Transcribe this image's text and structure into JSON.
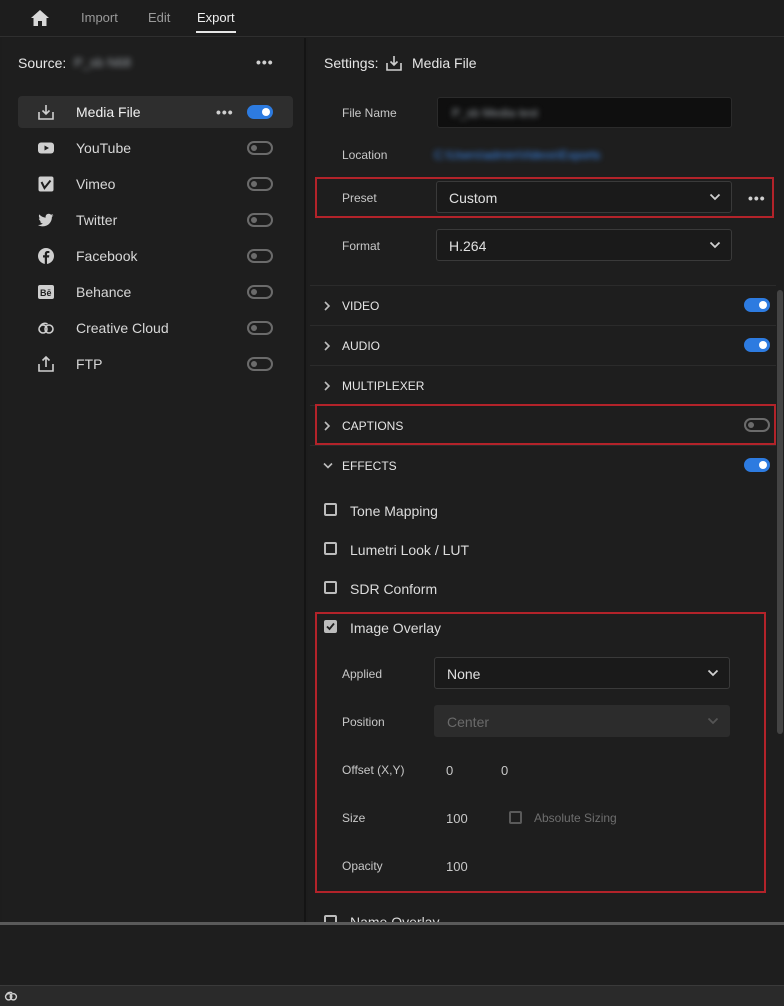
{
  "topbar": {
    "tabs": [
      {
        "label": "Import",
        "active": false
      },
      {
        "label": "Edit",
        "active": false
      },
      {
        "label": "Export",
        "active": true
      }
    ]
  },
  "source": {
    "label": "Source:",
    "value": "P_sb N68",
    "more": "•••"
  },
  "destinations": [
    {
      "label": "Media File",
      "icon": "download-icon",
      "enabled": true,
      "selected": true
    },
    {
      "label": "YouTube",
      "icon": "youtube-icon",
      "enabled": false
    },
    {
      "label": "Vimeo",
      "icon": "vimeo-icon",
      "enabled": false
    },
    {
      "label": "Twitter",
      "icon": "twitter-icon",
      "enabled": false
    },
    {
      "label": "Facebook",
      "icon": "facebook-icon",
      "enabled": false
    },
    {
      "label": "Behance",
      "icon": "behance-icon",
      "enabled": false
    },
    {
      "label": "Creative Cloud",
      "icon": "creative-cloud-icon",
      "enabled": false
    },
    {
      "label": "FTP",
      "icon": "share-upload-icon",
      "enabled": false
    }
  ],
  "settings": {
    "label": "Settings:",
    "target": "Media File",
    "more": "•••",
    "file_name_label": "File Name",
    "file_name_value": "P_sb Media test",
    "location_label": "Location",
    "location_value": "C:\\Users\\admin\\Videos\\Exports",
    "preset_label": "Preset",
    "preset_value": "Custom",
    "format_label": "Format",
    "format_value": "H.264"
  },
  "sections": [
    {
      "label": "VIDEO",
      "expanded": false,
      "toggle": true
    },
    {
      "label": "AUDIO",
      "expanded": false,
      "toggle": true
    },
    {
      "label": "MULTIPLEXER",
      "expanded": false,
      "toggle": null
    },
    {
      "label": "CAPTIONS",
      "expanded": false,
      "toggle": false
    },
    {
      "label": "EFFECTS",
      "expanded": true,
      "toggle": true
    }
  ],
  "effects": {
    "items": [
      {
        "label": "Tone Mapping",
        "checked": false
      },
      {
        "label": "Lumetri Look / LUT",
        "checked": false
      },
      {
        "label": "SDR Conform",
        "checked": false
      },
      {
        "label": "Image Overlay",
        "checked": true
      }
    ],
    "overlay": {
      "applied_label": "Applied",
      "applied_value": "None",
      "position_label": "Position",
      "position_value": "Center",
      "offset_label": "Offset (X,Y)",
      "offset_x": "0",
      "offset_y": "0",
      "size_label": "Size",
      "size_value": "100",
      "absolute_sizing_label": "Absolute Sizing",
      "absolute_sizing_checked": false,
      "opacity_label": "Opacity",
      "opacity_value": "100"
    },
    "next_item": "Name Overlay"
  },
  "colors": {
    "accent": "#2d7be0",
    "highlight_box": "#b3232a",
    "link": "#3b8cf5"
  }
}
